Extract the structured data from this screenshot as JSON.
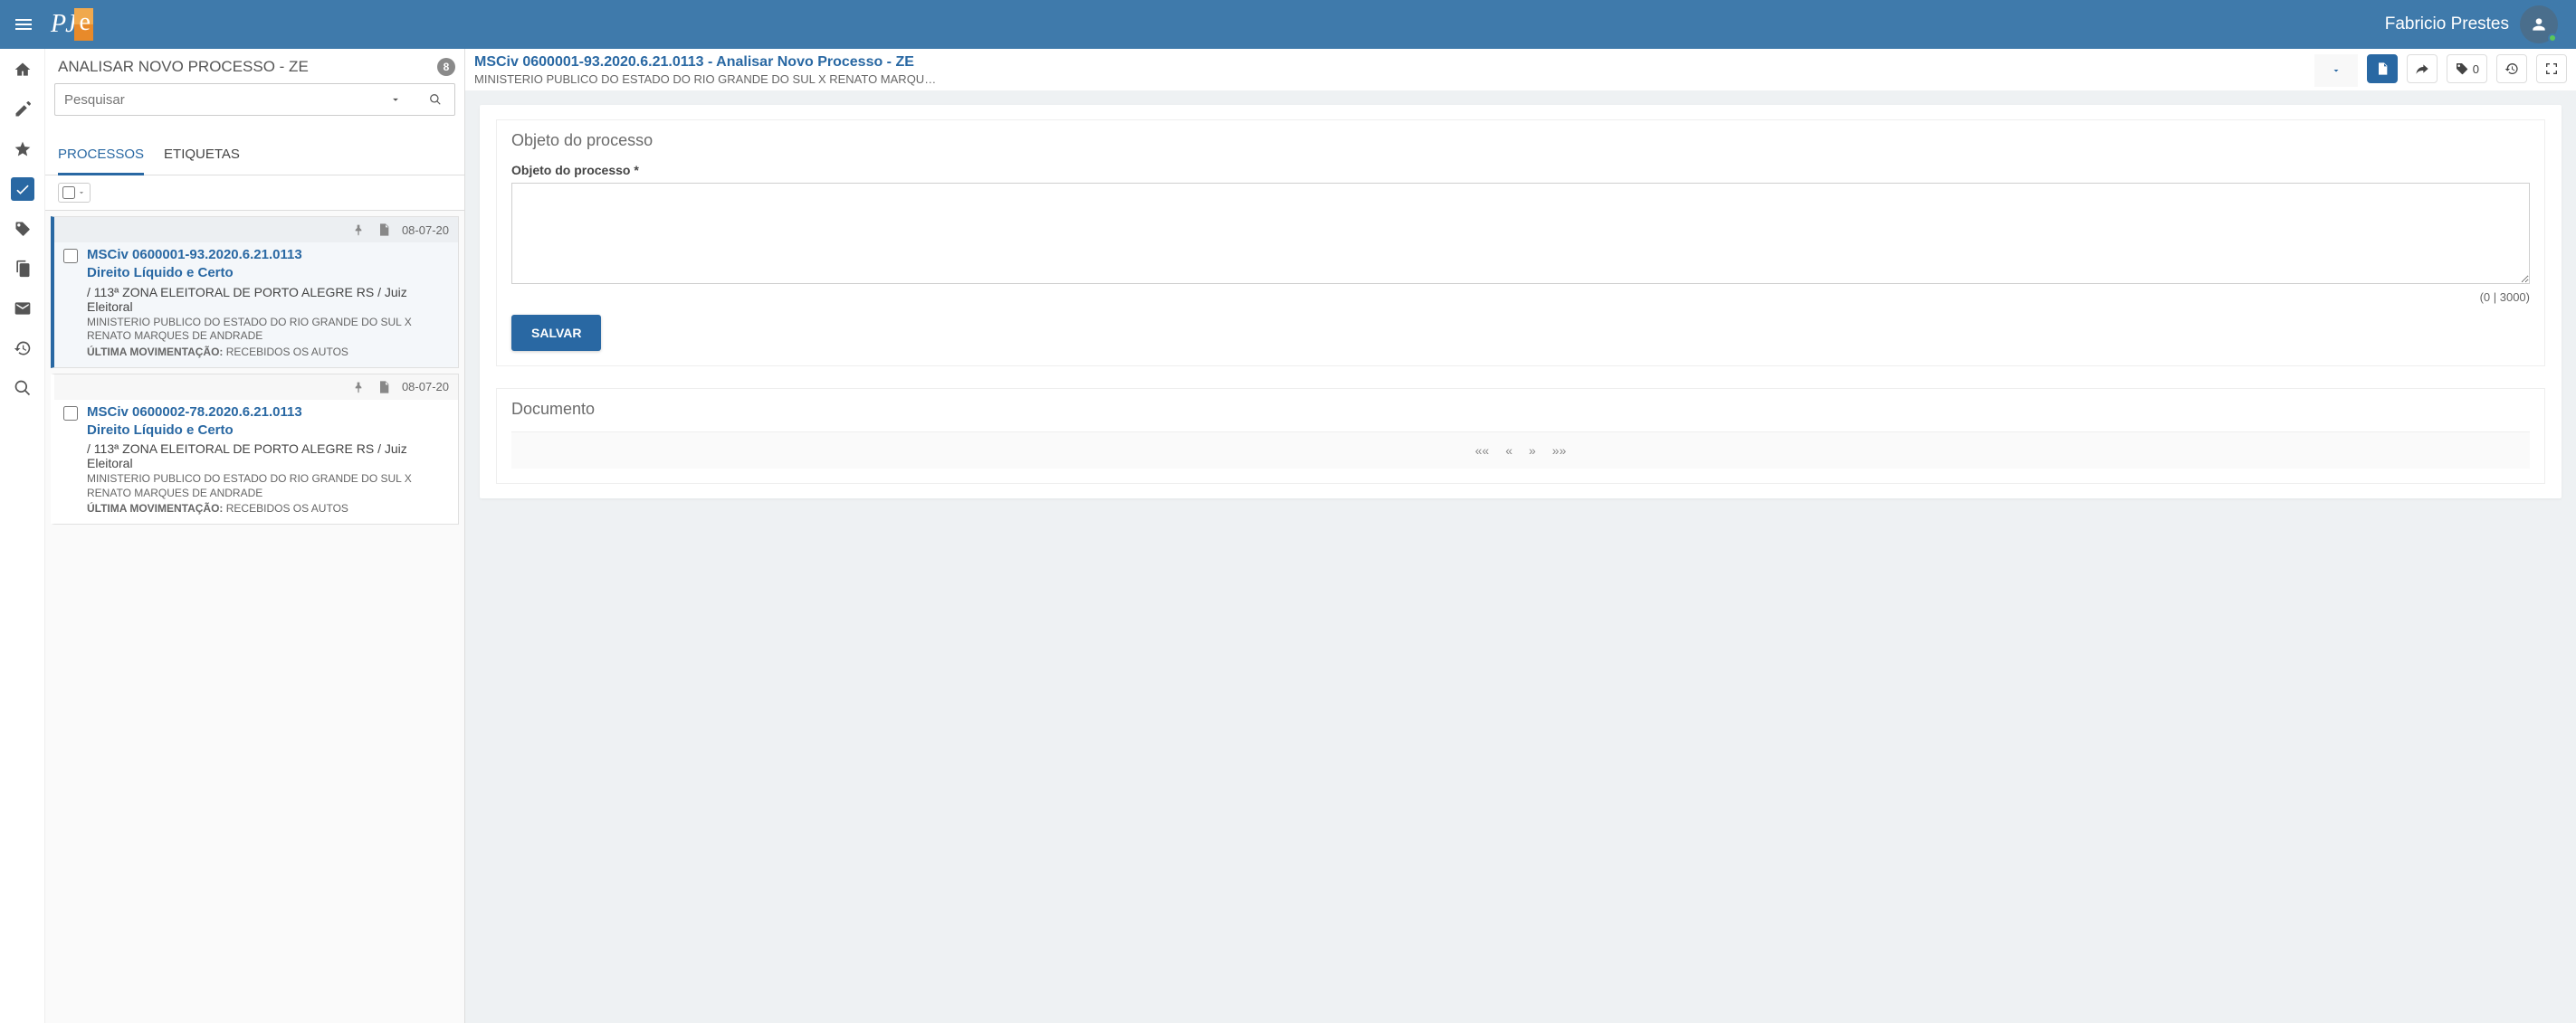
{
  "topbar": {
    "logo": {
      "p": "P",
      "j": "J",
      "e": "e"
    },
    "username": "Fabricio Prestes"
  },
  "leftPane": {
    "title": "ANALISAR NOVO PROCESSO - ZE",
    "count": "8",
    "search": {
      "placeholder": "Pesquisar",
      "value": ""
    },
    "tabs": {
      "processos": "PROCESSOS",
      "etiquetas": "ETIQUETAS"
    },
    "items": [
      {
        "selected": true,
        "date": "08-07-20",
        "number": "MSCiv 0600001-93.2020.6.21.0113",
        "subject": "Direito Líquido e Certo",
        "location": "/ 113ª ZONA ELEITORAL DE PORTO ALEGRE RS / Juiz Eleitoral",
        "parties": "MINISTERIO PUBLICO DO ESTADO DO RIO GRANDE DO SUL X RENATO MARQUES DE ANDRADE",
        "last_label": "ÚLTIMA MOVIMENTAÇÃO:",
        "last_value": "RECEBIDOS OS AUTOS"
      },
      {
        "selected": false,
        "date": "08-07-20",
        "number": "MSCiv 0600002-78.2020.6.21.0113",
        "subject": "Direito Líquido e Certo",
        "location": "/ 113ª ZONA ELEITORAL DE PORTO ALEGRE RS / Juiz Eleitoral",
        "parties": "MINISTERIO PUBLICO DO ESTADO DO RIO GRANDE DO SUL X RENATO MARQUES DE ANDRADE",
        "last_label": "ÚLTIMA MOVIMENTAÇÃO:",
        "last_value": "RECEBIDOS OS AUTOS"
      }
    ]
  },
  "rightPane": {
    "header": {
      "title": "MSCiv 0600001-93.2020.6.21.0113 - Analisar Novo Processo - ZE",
      "parties": "MINISTERIO PUBLICO DO ESTADO DO RIO GRANDE DO SUL X RENATO MARQU…",
      "tagCount": "0"
    },
    "form": {
      "panelTitle": "Objeto do processo",
      "fieldLabel": "Objeto do processo",
      "value": "",
      "charCount": "(0 | 3000)",
      "saveLabel": "SALVAR"
    },
    "documento": {
      "title": "Documento",
      "pager": {
        "first": "««",
        "prev": "«",
        "next": "»",
        "last": "»»"
      }
    }
  }
}
